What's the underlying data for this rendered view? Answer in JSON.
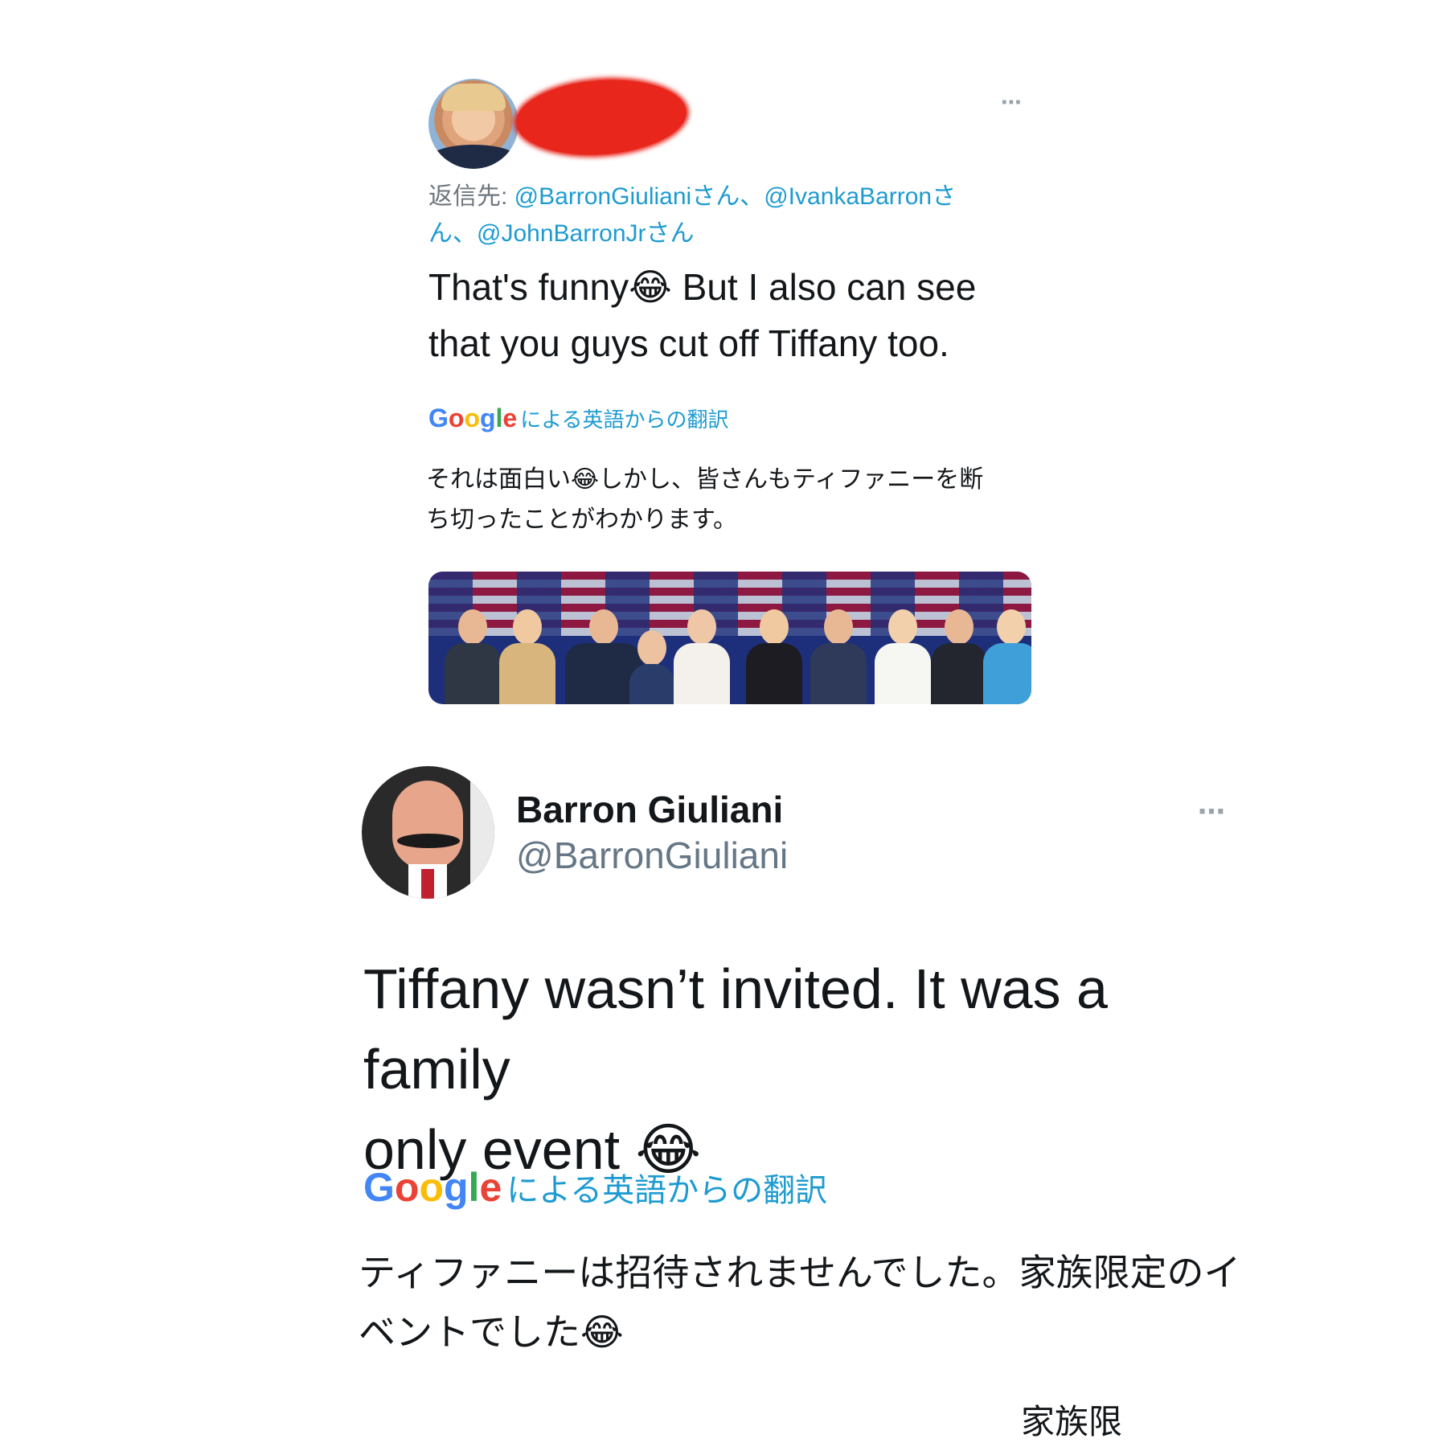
{
  "tweet_reply": {
    "reply_prefix": "返信先: ",
    "mentions_line1": "@BarronGiulianiさん、@IvankaBarronさ",
    "mentions_line2": "ん、@JohnBarronJrさん",
    "text_line1": "That's funny😂 But I also can see",
    "text_line2": "that you guys cut off Tiffany too.",
    "translate_label": "による英語からの翻訳",
    "translation_line1": "それは面白い😂しかし、皆さんもティファニーを断",
    "translation_line2": "ち切ったことがわかります。",
    "more_icon": "⋯"
  },
  "tweet_main": {
    "display_name": "Barron Giuliani",
    "handle": "@BarronGiuliani",
    "text_line1": "Tiffany wasn’t invited. It was a family",
    "text_line2": "only event 😂",
    "translate_label": "による英語からの翻訳",
    "translation_line1": "ティファニーは招待されませんでした。家族限定のイ",
    "translation_line2": "ベントでした😂",
    "more_icon": "⋯",
    "cutoff_text": "家族限"
  },
  "google_logo": {
    "g1": "G",
    "o1": "o",
    "o2": "o",
    "g2": "g",
    "l": "l",
    "e": "e"
  },
  "colors": {
    "link": "#1d9bd1",
    "redaction": "#e8261c",
    "google_blue": "#4285f4",
    "google_red": "#ea4335",
    "google_yellow": "#fbbc05",
    "google_green": "#34a853"
  }
}
